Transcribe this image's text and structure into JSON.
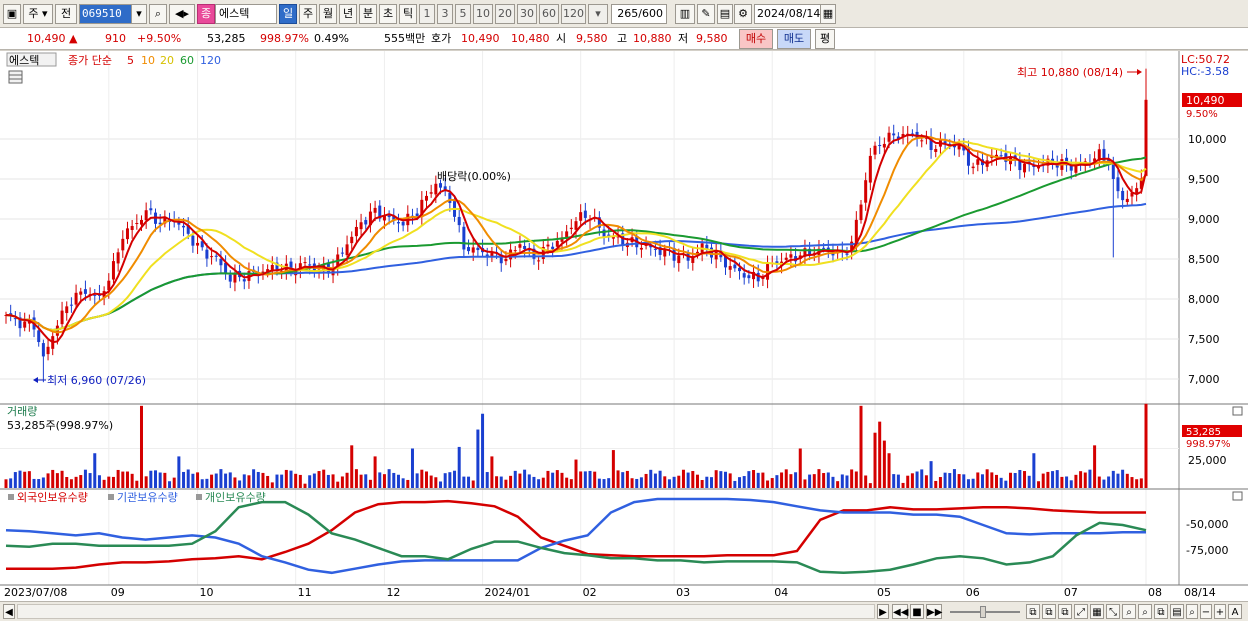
{
  "toolbar": {
    "period_label": "주",
    "front_label": "전",
    "code": "069510",
    "jong_label": "종",
    "stock_name": "에스텍",
    "periods": [
      "일",
      "주",
      "월",
      "년",
      "분",
      "초",
      "틱"
    ],
    "periods_selected": "일",
    "nums": [
      "1",
      "3",
      "5",
      "10",
      "20",
      "30",
      "60",
      "120"
    ],
    "count": "265",
    "count_total": "/600",
    "date": "2024/08/14"
  },
  "pricebar": {
    "price": "10,490 ▲",
    "change": "910",
    "change_pct": "+9.50%",
    "volume": "53,285",
    "volume_pct": "998.97%",
    "turnover": "0.49%",
    "amount": "555백만",
    "hoga_label": "호가",
    "hoga_ask": "10,490",
    "hoga_bid": "10,480",
    "open_label": "시",
    "open": "9,580",
    "high_label": "고",
    "high": "10,880",
    "low_label": "저",
    "low": "9,580",
    "buy_btn": "매수",
    "sell_btn": "매도",
    "eval_btn": "평"
  },
  "colors": {
    "up": "#d40000",
    "down": "#1a3fd0",
    "ma5": "#d40000",
    "ma10": "#f08c00",
    "ma20": "#f0e020",
    "ma60": "#1a9a30",
    "ma120": "#3060e0",
    "foreign": "#d40000",
    "inst": "#3060e0",
    "indiv": "#2a8a55"
  },
  "chart_data": [
    {
      "type": "line",
      "title": "",
      "legend_stock": "에스텍",
      "legend_desc": "종가 단순",
      "ma_periods": [
        "5",
        "10",
        "20",
        "60",
        "120"
      ],
      "lc_label": "LC:50.72",
      "hc_label": "HC:-3.58",
      "yticks": [
        "10,000",
        "9,500",
        "9,000",
        "8,500",
        "8,000",
        "7,500",
        "7,000"
      ],
      "ylim": [
        6750,
        10950
      ],
      "x_tick_labels": [
        "2023/07/08",
        "09",
        "10",
        "11",
        "12",
        "2024/01",
        "02",
        "03",
        "04",
        "05",
        "06",
        "07",
        "08",
        "08/14"
      ],
      "current_price_label": "10,490",
      "current_pct_label": "9.50%",
      "high_annot": "최고 10,880 (08/14)",
      "low_annot": "최저 6,960 (07/26)",
      "dividend_annot": "배당락(0.00%)",
      "anchors": [
        [
          0,
          7800
        ],
        [
          3,
          7700
        ],
        [
          6,
          7680
        ],
        [
          8,
          7250
        ],
        [
          11,
          7700
        ],
        [
          14,
          8000
        ],
        [
          17,
          8100
        ],
        [
          20,
          8000
        ],
        [
          23,
          8400
        ],
        [
          25,
          8800
        ],
        [
          28,
          8950
        ],
        [
          30,
          9100
        ],
        [
          33,
          8950
        ],
        [
          36,
          9000
        ],
        [
          39,
          8800
        ],
        [
          42,
          8600
        ],
        [
          45,
          8500
        ],
        [
          48,
          8250
        ],
        [
          52,
          8300
        ],
        [
          55,
          8350
        ],
        [
          58,
          8400
        ],
        [
          61,
          8350
        ],
        [
          64,
          8450
        ],
        [
          67,
          8350
        ],
        [
          70,
          8400
        ],
        [
          73,
          8700
        ],
        [
          76,
          8950
        ],
        [
          79,
          9100
        ],
        [
          82,
          9000
        ],
        [
          85,
          8950
        ],
        [
          88,
          9100
        ],
        [
          92,
          9450
        ],
        [
          95,
          9250
        ],
        [
          98,
          8650
        ],
        [
          101,
          8600
        ],
        [
          104,
          8550
        ],
        [
          107,
          8500
        ],
        [
          110,
          8700
        ],
        [
          113,
          8500
        ],
        [
          116,
          8650
        ],
        [
          119,
          8750
        ],
        [
          122,
          9000
        ],
        [
          125,
          9050
        ],
        [
          128,
          8800
        ],
        [
          131,
          8750
        ],
        [
          134,
          8700
        ],
        [
          137,
          8650
        ],
        [
          140,
          8600
        ],
        [
          143,
          8550
        ],
        [
          146,
          8500
        ],
        [
          149,
          8650
        ],
        [
          152,
          8550
        ],
        [
          155,
          8400
        ],
        [
          158,
          8300
        ],
        [
          161,
          8250
        ],
        [
          164,
          8450
        ],
        [
          167,
          8500
        ],
        [
          170,
          8550
        ],
        [
          173,
          8600
        ],
        [
          176,
          8620
        ],
        [
          179,
          8550
        ],
        [
          181,
          8700
        ],
        [
          183,
          9200
        ],
        [
          185,
          9800
        ],
        [
          188,
          10000
        ],
        [
          191,
          10050
        ],
        [
          195,
          10050
        ],
        [
          198,
          9900
        ],
        [
          201,
          9950
        ],
        [
          204,
          9900
        ],
        [
          207,
          9650
        ],
        [
          210,
          9750
        ],
        [
          213,
          9800
        ],
        [
          216,
          9700
        ],
        [
          219,
          9650
        ],
        [
          222,
          9700
        ],
        [
          225,
          9700
        ],
        [
          228,
          9650
        ],
        [
          231,
          9700
        ],
        [
          234,
          9800
        ],
        [
          236,
          9750
        ],
        [
          237,
          9450
        ],
        [
          239,
          9250
        ],
        [
          241,
          9300
        ],
        [
          242,
          9350
        ],
        [
          243,
          9580
        ],
        [
          244,
          10490
        ]
      ]
    },
    {
      "type": "bar",
      "title": "거래량",
      "value_label": "53,285주(998.97%)",
      "yticks": [
        "25,000"
      ],
      "current_label": "53,285",
      "current_pct_label": "998.97%",
      "spikes": [
        [
          29,
          52000
        ],
        [
          19,
          22000
        ],
        [
          37,
          20000
        ],
        [
          74,
          27000
        ],
        [
          79,
          20000
        ],
        [
          87,
          25000
        ],
        [
          97,
          26000
        ],
        [
          101,
          37000
        ],
        [
          102,
          47000
        ],
        [
          104,
          20000
        ],
        [
          122,
          18000
        ],
        [
          130,
          24000
        ],
        [
          170,
          25000
        ],
        [
          183,
          52000
        ],
        [
          186,
          35000
        ],
        [
          187,
          42000
        ],
        [
          188,
          30000
        ],
        [
          189,
          22000
        ],
        [
          198,
          17000
        ],
        [
          220,
          22000
        ],
        [
          233,
          27000
        ],
        [
          244,
          53285
        ]
      ]
    },
    {
      "type": "line",
      "title": "",
      "series": [
        {
          "name": "외국인보유수량",
          "values": [
            -92000,
            -92000,
            -92000,
            -91000,
            -88000,
            -86000,
            -86000,
            -85000,
            -83000,
            -82000,
            -80000,
            -83000,
            -76000,
            -68000,
            -55000,
            -38000,
            -30000,
            -28000,
            -28000,
            -27000,
            -29000,
            -32000,
            -42000,
            -62000,
            -70000,
            -78000,
            -79000,
            -80000,
            -80000,
            -80000,
            -80000,
            -79000,
            -79000,
            -79000,
            -75000,
            -45000,
            -36000,
            -36000,
            -33000,
            -35000,
            -35000,
            -34000,
            -33000,
            -33000,
            -34000,
            -36000,
            -37000,
            -38000,
            -38000,
            -38000
          ]
        },
        {
          "name": "기관보유수량",
          "values": [
            -55000,
            -56000,
            -58000,
            -60000,
            -58000,
            -62000,
            -64000,
            -62000,
            -60000,
            -62000,
            -68000,
            -80000,
            -86000,
            -93000,
            -96000,
            -92000,
            -88000,
            -85000,
            -84000,
            -84000,
            -84000,
            -84000,
            -84000,
            -72000,
            -65000,
            -60000,
            -38000,
            -28000,
            -25000,
            -25000,
            -25000,
            -25000,
            -26000,
            -28000,
            -32000,
            -36000,
            -38000,
            -38000,
            -38000,
            -40000,
            -40000,
            -42000,
            -50000,
            -58000,
            -59000,
            -58000,
            -58000,
            -58000,
            -57000,
            -57000
          ]
        },
        {
          "name": "개인보유수량",
          "values": [
            -70000,
            -71000,
            -68000,
            -68000,
            -70000,
            -70000,
            -70000,
            -70000,
            -68000,
            -56000,
            -33000,
            -28000,
            -28000,
            -40000,
            -58000,
            -64000,
            -72000,
            -80000,
            -80000,
            -83000,
            -73000,
            -66000,
            -66000,
            -72000,
            -77000,
            -79000,
            -82000,
            -82000,
            -84000,
            -84000,
            -86000,
            -85000,
            -85000,
            -85000,
            -86000,
            -95000,
            -96000,
            -95000,
            -93000,
            -88000,
            -82000,
            -80000,
            -82000,
            -88000,
            -86000,
            -80000,
            -60000,
            -48000,
            -50000,
            -55000
          ]
        }
      ],
      "yticks": [
        "-50,000",
        "-75,000"
      ]
    }
  ],
  "bottombar": {
    "play_prev": "◀",
    "play_next": "▶",
    "zoom_minus": "−",
    "zoom_plus": "+",
    "auto_label": "A"
  }
}
